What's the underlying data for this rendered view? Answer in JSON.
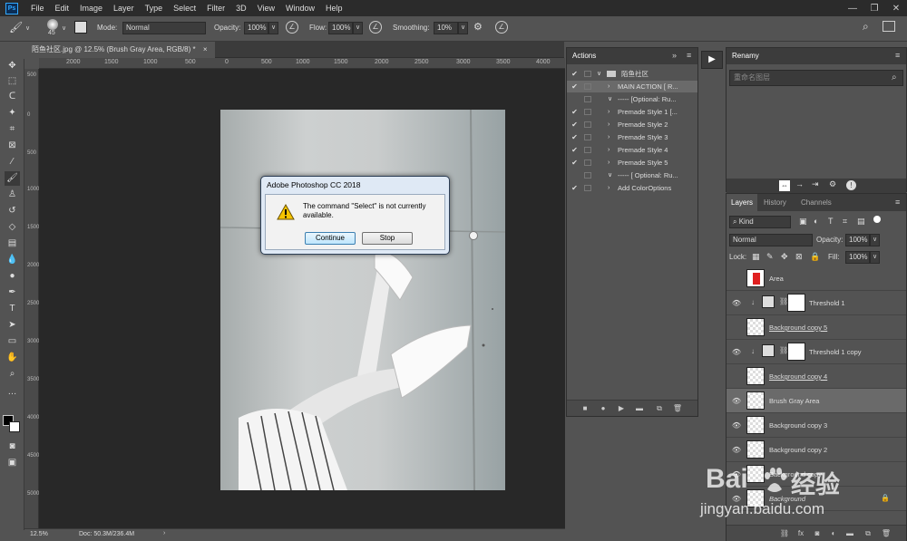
{
  "menubar": {
    "logo": "Ps",
    "items": [
      "File",
      "Edit",
      "Image",
      "Layer",
      "Type",
      "Select",
      "Filter",
      "3D",
      "View",
      "Window",
      "Help"
    ],
    "window_controls": [
      "—",
      "❐",
      "✕"
    ]
  },
  "options": {
    "brush_size": "45",
    "mode_label": "Mode:",
    "mode_value": "Normal",
    "opacity_label": "Opacity:",
    "opacity_value": "100%",
    "flow_label": "Flow:",
    "flow_value": "100%",
    "smoothing_label": "Smoothing:",
    "smoothing_value": "10%"
  },
  "document": {
    "tab_title": "陌鱼社区.jpg @ 12.5% (Brush Gray Area, RGB/8) *",
    "tab_close": "×",
    "ruler_top": [
      "2000",
      "1500",
      "1000",
      "500",
      "0",
      "500",
      "1000",
      "1500",
      "2000",
      "2500",
      "3000",
      "3500",
      "4000"
    ],
    "ruler_left": [
      "500",
      "0",
      "500",
      "1000",
      "1500",
      "2000",
      "2500",
      "3000",
      "3500",
      "4000",
      "4500",
      "5000"
    ],
    "zoom": "12.5%",
    "doc_info": "Doc: 50.3M/236.4M"
  },
  "dialog": {
    "title": "Adobe Photoshop CC 2018",
    "message": "The command \"Select\" is not currently available.",
    "continue_label": "Continue",
    "stop_label": "Stop"
  },
  "actions_panel": {
    "title": "Actions",
    "rows": [
      {
        "check": "✔",
        "twisty": "∨",
        "name": "陌鱼社区",
        "folder": true
      },
      {
        "check": "✔",
        "twisty": "›",
        "name": "MAIN ACTION [ R..."
      },
      {
        "check": "",
        "twisty": "∨",
        "name": "----- [Optional: Ru..."
      },
      {
        "check": "✔",
        "twisty": "›",
        "name": "Premade Style 1 [..."
      },
      {
        "check": "✔",
        "twisty": "›",
        "name": "Premade Style 2"
      },
      {
        "check": "✔",
        "twisty": "›",
        "name": "Premade Style 3"
      },
      {
        "check": "✔",
        "twisty": "›",
        "name": "Premade Style 4"
      },
      {
        "check": "✔",
        "twisty": "›",
        "name": "Premade Style 5"
      },
      {
        "check": "",
        "twisty": "∨",
        "name": "----- [ Optional: Ru..."
      },
      {
        "check": "✔",
        "twisty": "›",
        "name": "Add ColorOptions"
      }
    ]
  },
  "renamy_panel": {
    "title": "Renamy",
    "placeholder": "重命名图层"
  },
  "layers_panel": {
    "tabs": [
      "Layers",
      "History",
      "Channels"
    ],
    "kind_label": "Kind",
    "blend_mode": "Normal",
    "opacity_label": "Opacity:",
    "opacity_value": "100%",
    "lock_label": "Lock:",
    "fill_label": "Fill:",
    "fill_value": "100%",
    "layers": [
      {
        "name": "Area",
        "visible": false,
        "type": "pixel"
      },
      {
        "name": "Threshold 1",
        "visible": true,
        "type": "adjustment"
      },
      {
        "name": "Background copy 5",
        "visible": false,
        "type": "pixel",
        "underline": true
      },
      {
        "name": "Threshold 1 copy",
        "visible": true,
        "type": "adjustment"
      },
      {
        "name": "Background copy 4",
        "visible": false,
        "type": "pixel",
        "underline": true
      },
      {
        "name": "Brush Gray Area",
        "visible": true,
        "type": "pixel",
        "selected": true
      },
      {
        "name": "Background copy 3",
        "visible": true,
        "type": "pixel"
      },
      {
        "name": "Background copy 2",
        "visible": true,
        "type": "pixel"
      },
      {
        "name": "Background copy",
        "visible": true,
        "type": "pixel"
      },
      {
        "name": "Background",
        "visible": true,
        "type": "pixel",
        "locked": true
      }
    ]
  },
  "watermark": {
    "brand_latin": "Bai",
    "brand_cn": "经验",
    "url": "jingyan.baidu.com"
  },
  "colors": {
    "app_bg": "#535353",
    "menubar_bg": "#2b2b2b",
    "canvas_bg": "#282828",
    "accent": "#31a8ff"
  }
}
